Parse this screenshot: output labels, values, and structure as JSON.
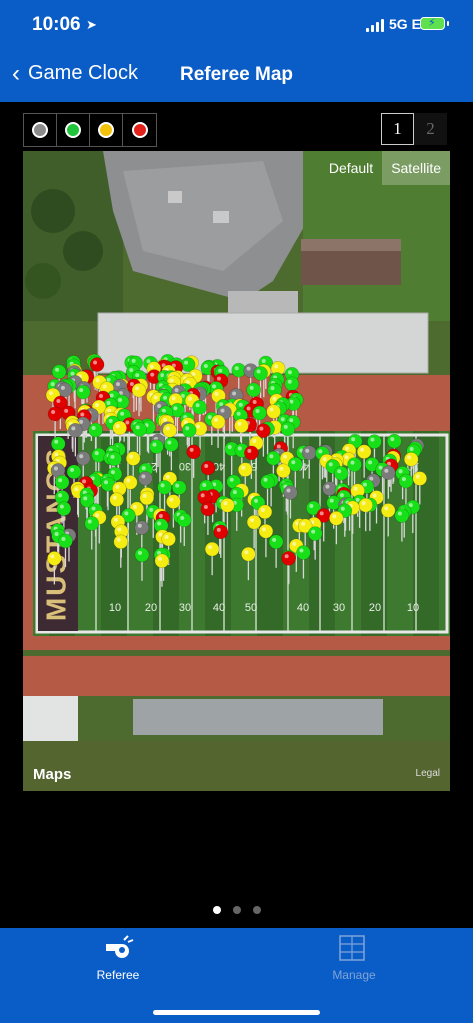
{
  "status": {
    "time": "10:06",
    "network": "5G E"
  },
  "nav": {
    "back_label": "Game Clock",
    "title": "Referee Map"
  },
  "filters": [
    {
      "name": "gray",
      "color": "#8a8a8a"
    },
    {
      "name": "green",
      "color": "#1fc43b"
    },
    {
      "name": "yellow",
      "color": "#f2c20b"
    },
    {
      "name": "red",
      "color": "#e0221b"
    }
  ],
  "pages": {
    "page1": "1",
    "page2": "2"
  },
  "map": {
    "map_type_default": "Default",
    "map_type_satellite": "Satellite",
    "maps_brand": "Maps",
    "legal": "Legal",
    "endzone_text": "MUSTANGS",
    "yard_numbers_bottom": [
      "10",
      "20",
      "30",
      "40",
      "50",
      "40",
      "30",
      "20",
      "10"
    ],
    "yard_numbers_top": [
      "10",
      "20",
      "30",
      "40",
      "50",
      "40",
      "30",
      "20",
      "10"
    ]
  },
  "tabs": {
    "referee": "Referee",
    "manage": "Manage"
  },
  "colors": {
    "bar_blue": "#0a5cc6",
    "pin_green": "#18e018",
    "pin_yellow": "#f5ec12",
    "pin_red": "#e00000",
    "pin_gray": "#7b7b7b"
  }
}
